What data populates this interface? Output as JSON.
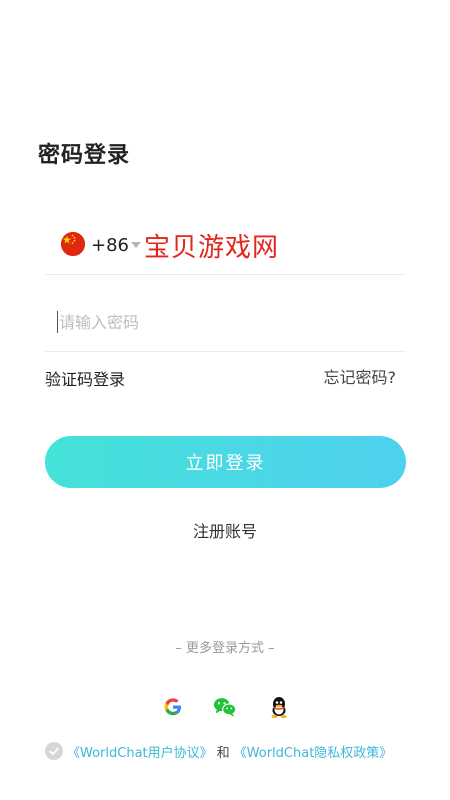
{
  "title": "密码登录",
  "phone": {
    "flag": "china-flag-icon",
    "country_code": "+86",
    "watermark": "宝贝游戏网"
  },
  "password": {
    "placeholder": "请输入密码",
    "value": ""
  },
  "links": {
    "sms_login": "验证码登录",
    "forgot_password": "忘记密码?"
  },
  "login_button": "立即登录",
  "register": "注册账号",
  "more_login": "– 更多登录方式 –",
  "social": [
    "google-icon",
    "wechat-icon",
    "qq-icon"
  ],
  "agreement": {
    "user_agreement": "《WorldChat用户协议》",
    "and": "和",
    "privacy_policy": "《WorldChat隐私权政策》"
  },
  "colors": {
    "accent_start": "#44e2d8",
    "accent_end": "#4fd0ef",
    "link": "#3cb8d9",
    "watermark": "#e3261b"
  }
}
